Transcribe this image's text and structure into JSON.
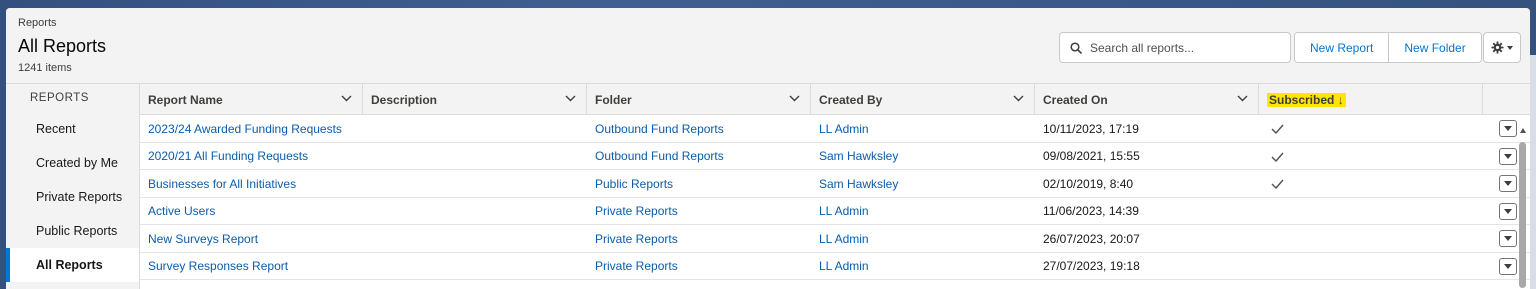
{
  "header": {
    "breadcrumb": "Reports",
    "title": "All Reports",
    "item_count": "1241 items"
  },
  "search": {
    "placeholder": "Search all reports..."
  },
  "toolbar": {
    "new_report_label": "New Report",
    "new_folder_label": "New Folder",
    "settings_icon": "gear-icon"
  },
  "sidebar": {
    "heading": "REPORTS",
    "items": [
      {
        "label": "Recent",
        "active": false
      },
      {
        "label": "Created by Me",
        "active": false
      },
      {
        "label": "Private Reports",
        "active": false
      },
      {
        "label": "Public Reports",
        "active": false
      },
      {
        "label": "All Reports",
        "active": true
      }
    ]
  },
  "table": {
    "columns": [
      {
        "label": "Report Name"
      },
      {
        "label": "Description"
      },
      {
        "label": "Folder"
      },
      {
        "label": "Created By"
      },
      {
        "label": "Created On"
      },
      {
        "label": "Subscribed",
        "sort": "↓",
        "highlight": "#ffe500"
      }
    ],
    "rows": [
      {
        "name": "2023/24 Awarded Funding Requests",
        "description": "",
        "folder": "Outbound Fund Reports",
        "created_by": "LL Admin",
        "created_on": "10/11/2023, 17:19",
        "subscribed": true
      },
      {
        "name": "2020/21 All Funding Requests",
        "description": "",
        "folder": "Outbound Fund Reports",
        "created_by": "Sam Hawksley",
        "created_on": "09/08/2021, 15:55",
        "subscribed": true
      },
      {
        "name": "Businesses for All Initiatives",
        "description": "",
        "folder": "Public Reports",
        "created_by": "Sam Hawksley",
        "created_on": "02/10/2019, 8:40",
        "subscribed": true
      },
      {
        "name": "Active Users",
        "description": "",
        "folder": "Private Reports",
        "created_by": "LL Admin",
        "created_on": "11/06/2023, 14:39",
        "subscribed": false
      },
      {
        "name": "New Surveys Report",
        "description": "",
        "folder": "Private Reports",
        "created_by": "LL Admin",
        "created_on": "26/07/2023, 20:07",
        "subscribed": false
      },
      {
        "name": "Survey Responses Report",
        "description": "",
        "folder": "Private Reports",
        "created_by": "LL Admin",
        "created_on": "27/07/2023, 19:18",
        "subscribed": false
      }
    ]
  },
  "colors": {
    "link": "#0b5cab",
    "accent": "#0176d3",
    "highlight": "#ffe500"
  }
}
